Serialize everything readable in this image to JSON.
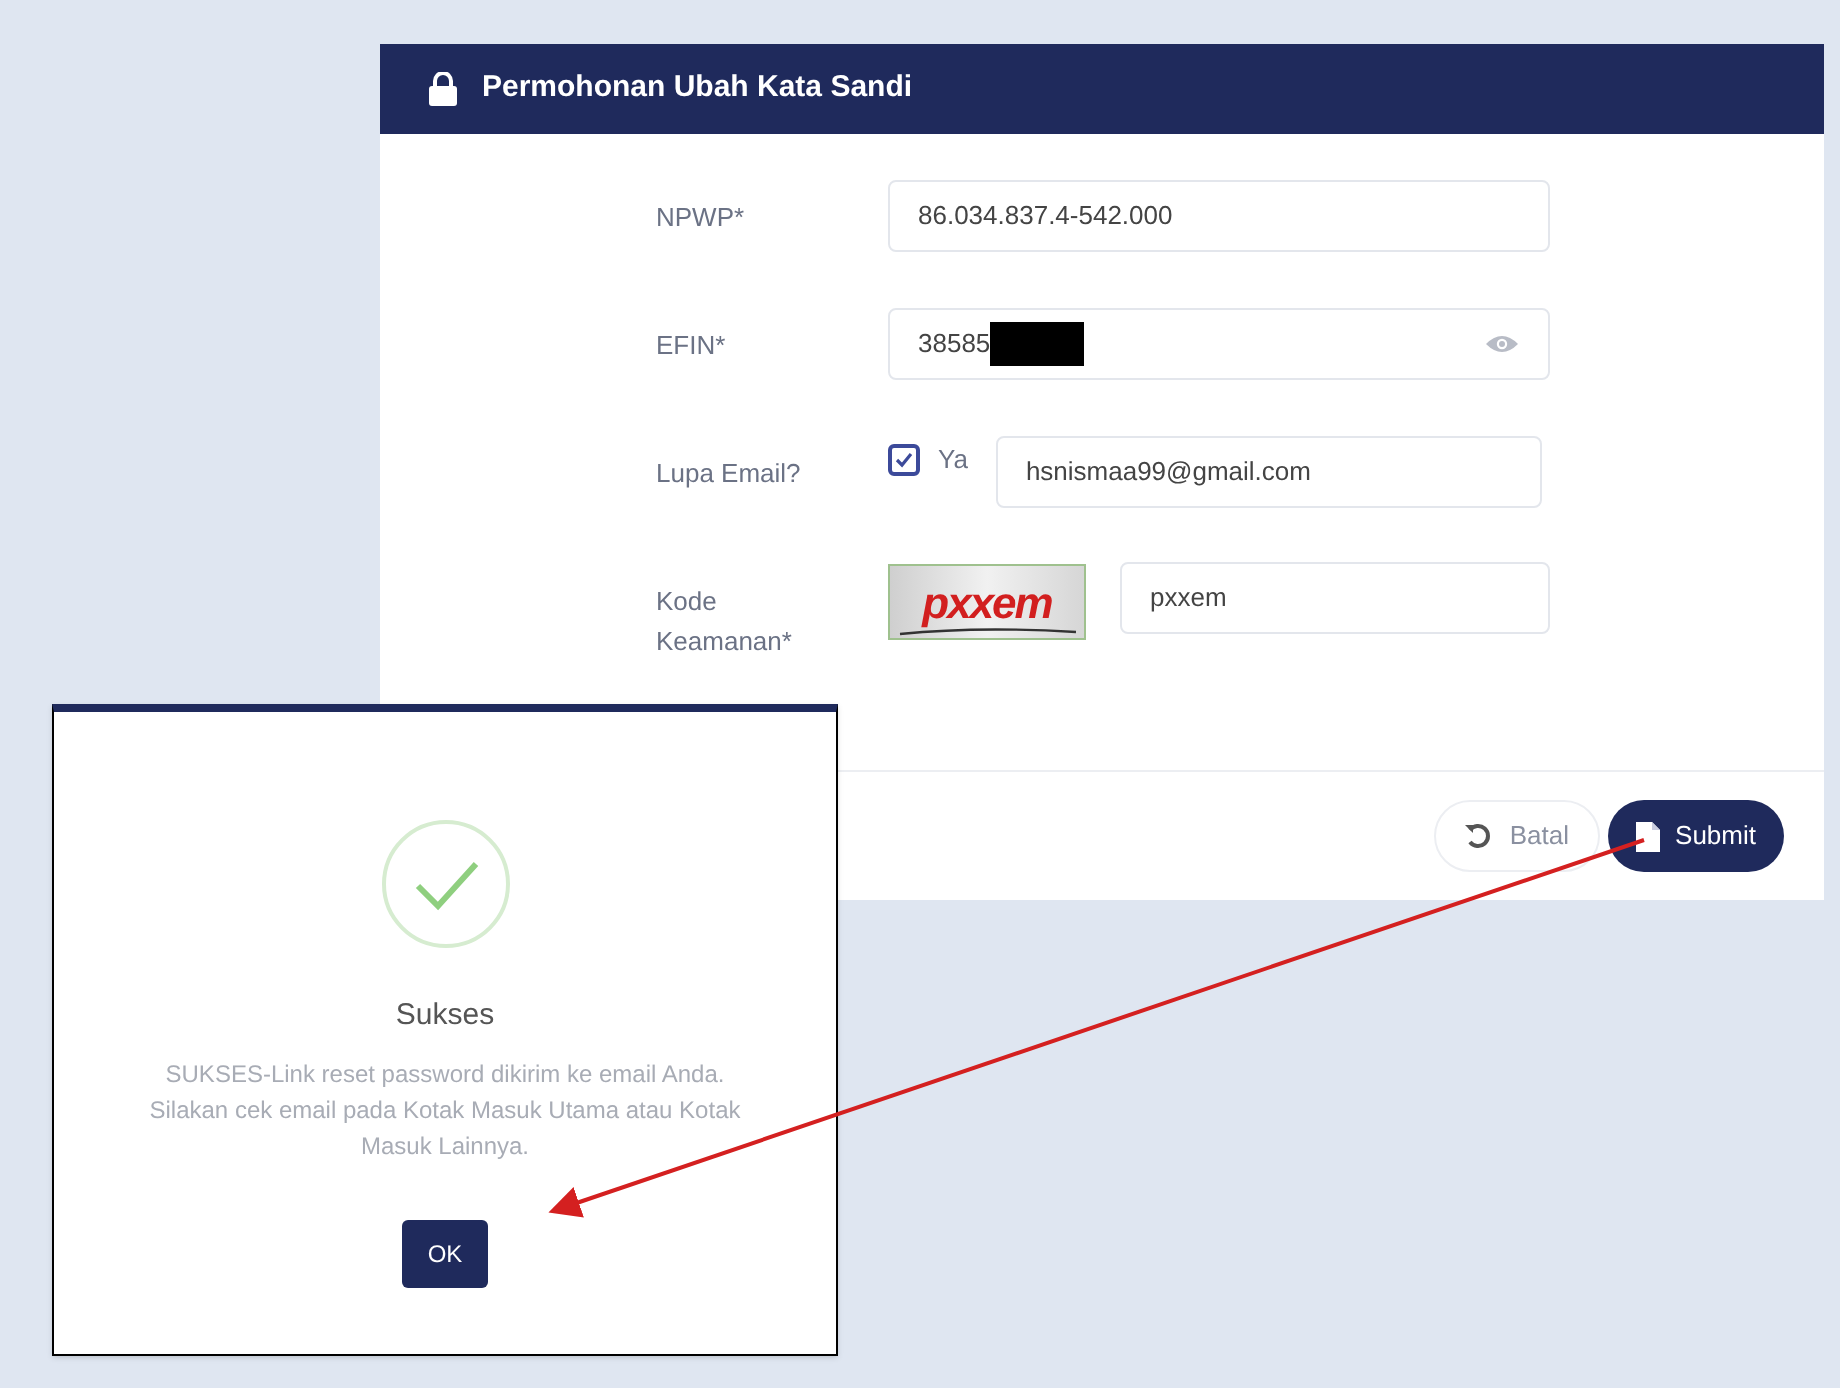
{
  "panel": {
    "title": "Permohonan Ubah Kata Sandi"
  },
  "fields": [
    {
      "kind": "text",
      "label": "NPWP*",
      "value": "86.034.837.4-542.000"
    },
    {
      "kind": "secret",
      "label": "EFIN*",
      "value": "38585",
      "redacted": true
    },
    {
      "kind": "email",
      "label": "Lupa Email?",
      "checkbox_label": "Ya",
      "checked": true,
      "value": "hsnismaa99@gmail.com"
    },
    {
      "kind": "captcha",
      "label": "Kode Keamanan*",
      "captcha_text": "pxxem",
      "value": "pxxem"
    }
  ],
  "buttons": [
    {
      "kind": "secondary",
      "label": "Batal"
    },
    {
      "kind": "primary",
      "label": "Submit"
    }
  ],
  "dialog": {
    "title": "Sukses",
    "message": "SUKSES-Link reset password dikirim ke email Anda. Silakan cek email pada Kotak Masuk Utama atau Kotak Masuk Lainnya.",
    "button": "OK"
  }
}
